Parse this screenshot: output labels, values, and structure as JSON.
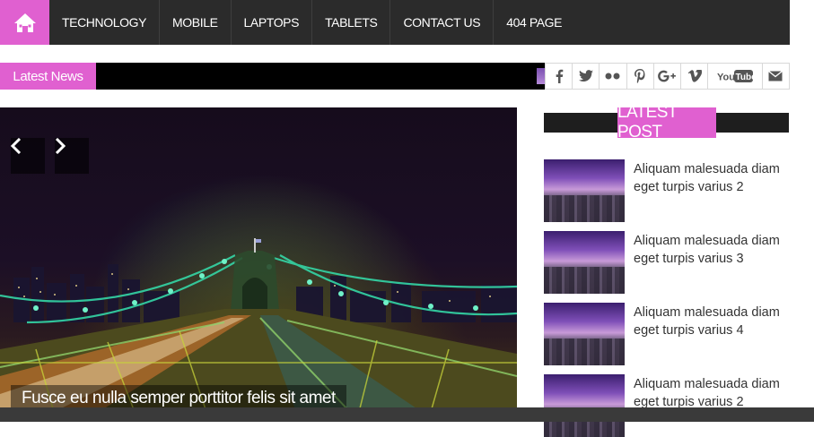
{
  "nav": {
    "home_icon": "home-icon",
    "accent": "#e060d0",
    "items": [
      {
        "label": "TECHNOLOGY"
      },
      {
        "label": "MOBILE"
      },
      {
        "label": "LAPTOPS"
      },
      {
        "label": "TABLETS"
      },
      {
        "label": "CONTACT US"
      },
      {
        "label": "404 PAGE"
      }
    ]
  },
  "ticker": {
    "label": "Latest News"
  },
  "social": [
    {
      "icon": "facebook-icon",
      "glyph": "f"
    },
    {
      "icon": "twitter-icon",
      "glyph": "t"
    },
    {
      "icon": "flickr-icon",
      "glyph": "••"
    },
    {
      "icon": "pinterest-icon",
      "glyph": "P"
    },
    {
      "icon": "google-plus-icon",
      "glyph": "g+"
    },
    {
      "icon": "vimeo-icon",
      "glyph": "V"
    },
    {
      "icon": "youtube-icon",
      "glyph": "YouTube"
    },
    {
      "icon": "mail-icon",
      "glyph": "✉"
    }
  ],
  "slider": {
    "caption": "Fusce eu nulla semper porttitor felis sit amet",
    "prev_icon": "chevron-left-icon",
    "next_icon": "chevron-right-icon"
  },
  "sidebar": {
    "title": "LATEST POST",
    "posts": [
      {
        "title": "Aliquam malesuada diam eget turpis varius 2"
      },
      {
        "title": "Aliquam malesuada diam eget turpis varius 3"
      },
      {
        "title": "Aliquam malesuada diam eget turpis varius 4"
      },
      {
        "title": "Aliquam malesuada diam eget turpis varius 2"
      }
    ]
  }
}
